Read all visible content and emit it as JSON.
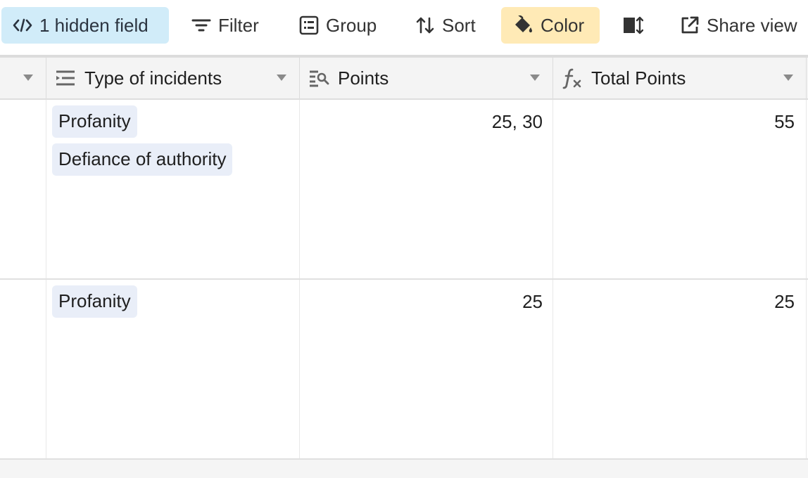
{
  "toolbar": {
    "hidden_fields_label": "1 hidden field",
    "filter_label": "Filter",
    "group_label": "Group",
    "sort_label": "Sort",
    "color_label": "Color",
    "share_label": "Share view",
    "colors": {
      "hidden_bg": "#d1ecf9",
      "color_bg": "#ffeab6"
    }
  },
  "columns": [
    {
      "label": "",
      "icon": "caret-only"
    },
    {
      "label": "Type of incidents",
      "icon": "multiple-select-icon"
    },
    {
      "label": "Points",
      "icon": "lookup-icon"
    },
    {
      "label": "Total Points",
      "icon": "formula-icon"
    }
  ],
  "rows": [
    {
      "incidents": [
        "Profanity",
        "Defiance of authority"
      ],
      "points": "25, 30",
      "total": "55"
    },
    {
      "incidents": [
        "Profanity"
      ],
      "points": "25",
      "total": "25"
    }
  ]
}
